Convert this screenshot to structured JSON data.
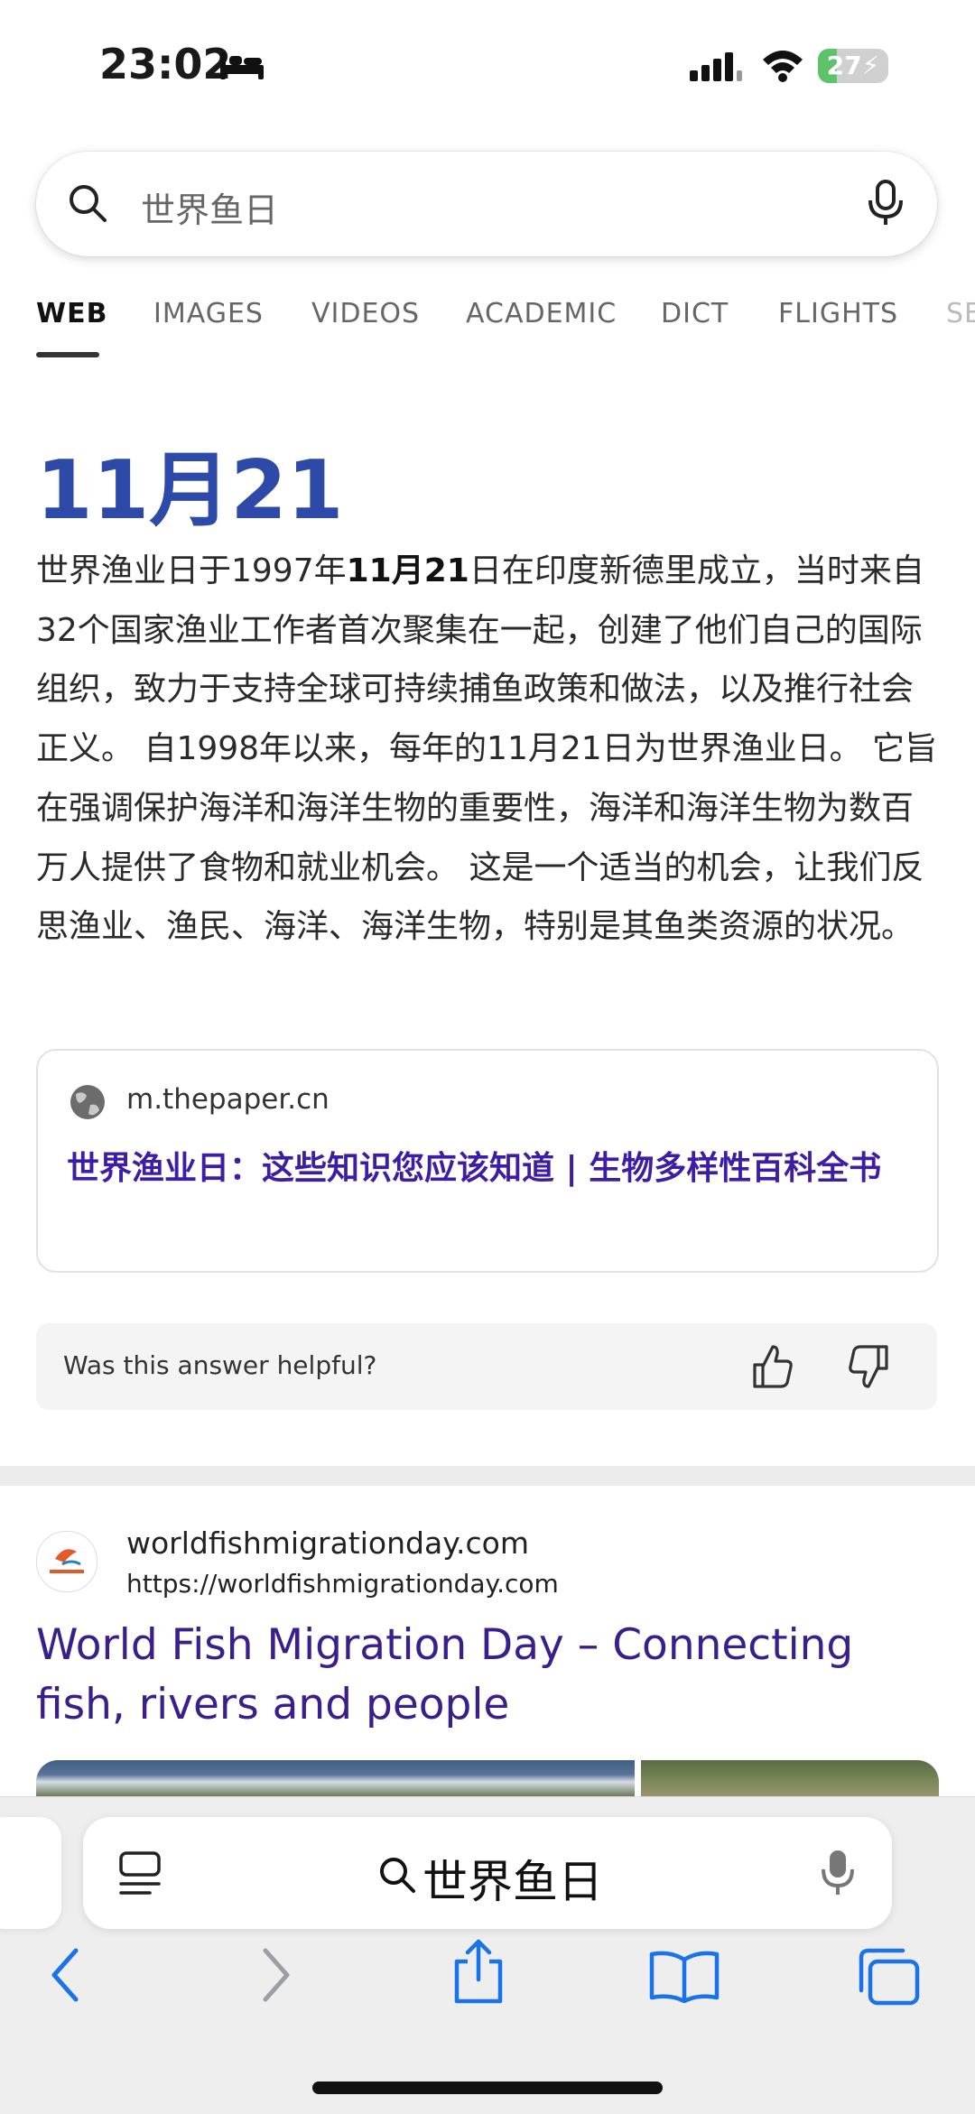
{
  "status": {
    "time": "23:02",
    "battery": "27",
    "battery_level": 0.27
  },
  "search": {
    "query": "世界鱼日"
  },
  "tabs": [
    "WEB",
    "IMAGES",
    "VIDEOS",
    "ACADEMIC",
    "DICT",
    "FLIGHTS",
    "SE"
  ],
  "answer": {
    "title": "11月21",
    "text_before": "世界渔业日于1997年",
    "text_bold": "11月21",
    "text_after": "日在印度新德里成立，当时来自32个国家渔业工作者首次聚集在一起，创建了他们自己的国际组织，致力于支持全球可持续捕鱼政策和做法，以及推行社会正义。 自1998年以来，每年的11月21日为世界渔业日。 它旨在强调保护海洋和海洋生物的重要性，海洋和海洋生物为数百万人提供了食物和就业机会。 这是一个适当的机会，让我们反思渔业、渔民、海洋、海洋生物，特别是其鱼类资源的状况。"
  },
  "source": {
    "domain": "m.thepaper.cn",
    "link": "世界渔业日：这些知识您应该知道 | 生物多样性百科全书"
  },
  "feedback": {
    "question": "Was this answer helpful?"
  },
  "result": {
    "site": "worldfishmigrationday.com",
    "url": "https://worldfishmigrationday.com",
    "title": "World Fish Migration Day – Connecting fish, rivers and people"
  },
  "browser": {
    "address_text": "世界鱼日"
  }
}
